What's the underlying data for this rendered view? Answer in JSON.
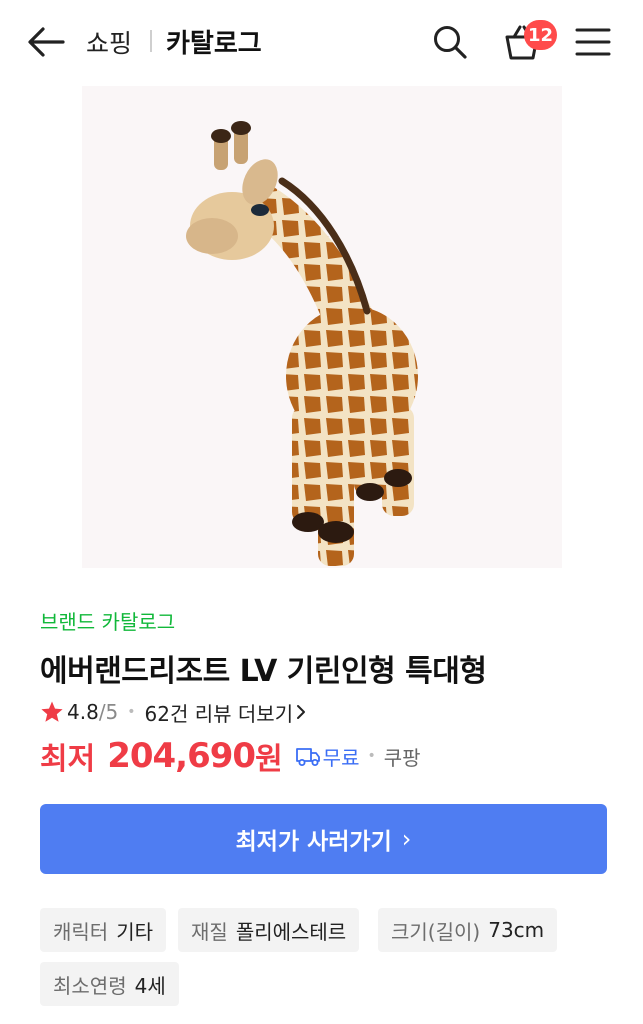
{
  "header": {
    "breadcrumb_shop": "쇼핑",
    "breadcrumb_catalog": "카탈로그",
    "cart_count": "12",
    "icons": [
      "back-arrow-icon",
      "search-icon",
      "shopping-bag-icon",
      "hamburger-menu-icon"
    ]
  },
  "product": {
    "image_alt": "giraffe-plush-image",
    "brand_label": "브랜드 카탈로그",
    "title": "에버랜드리조트 LV 기린인형 특대형",
    "rating": "4.8",
    "rating_max": "/5",
    "review_link": "62건 리뷰 더보기",
    "price_label": "최저",
    "price": "204,690",
    "price_unit": "원",
    "shipping": "무료",
    "seller": "쿠팡"
  },
  "cta": {
    "label": "최저가 사러가기",
    "chevron": "›"
  },
  "specs": [
    {
      "key": "캐릭터",
      "value": "기타"
    },
    {
      "key": "재질",
      "value": "폴리에스테르"
    },
    {
      "key": "크기(길이)",
      "value": "73cm"
    },
    {
      "key": "최소연령",
      "value": "4세"
    }
  ],
  "colors": {
    "brand_green": "#11b83a",
    "price_red": "#ef3c46",
    "cta_blue": "#4f7df2",
    "badge_red": "#ff4b4b",
    "shipping_blue": "#3b6ef5"
  }
}
